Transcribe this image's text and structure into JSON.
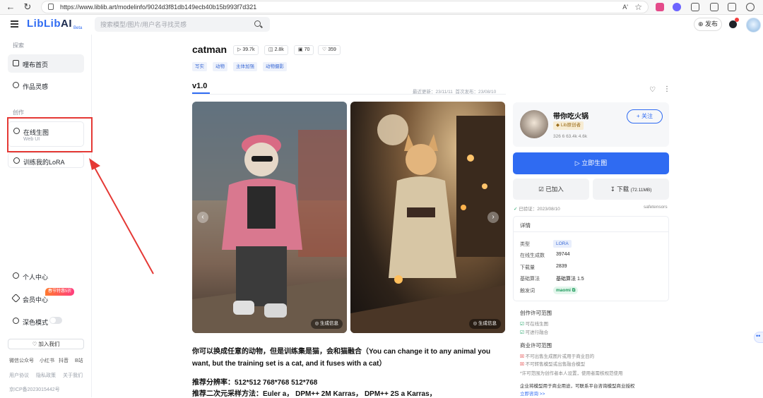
{
  "browser": {
    "url": "https://www.liblib.art/modelinfo/9024d3f81db149ecb40b15b993f7d321",
    "reader_label": "Aʹ"
  },
  "header": {
    "logo": "LibLib",
    "logo_suffix": "AI",
    "logo_beta": "Beta",
    "search_placeholder": "搜索模型/图片/用户名寻找灵感",
    "publish_label": "发布"
  },
  "sidebar": {
    "section_explore": "探索",
    "home_label": "哩布首页",
    "inspiration_label": "作品灵感",
    "section_create": "创作",
    "create_label": "在线生图",
    "create_sub": "Web UI",
    "train_label": "训练我的LoRA",
    "profile_label": "个人中心",
    "vip_label": "会员中心",
    "vip_badge": "春节特惠5折",
    "dark_label": "深色模式",
    "join_label": "加入我们",
    "footer_row1": [
      "微信公众号",
      "小红书",
      "抖音",
      "B站"
    ],
    "footer_row2": [
      "用户协议",
      "隐私政策",
      "关于我们"
    ],
    "icp": "京ICP备2023015442号"
  },
  "model": {
    "title": "catman",
    "stats": {
      "runs": "39.7k",
      "downloads": "2.8k",
      "images": "70",
      "likes": "359"
    },
    "tags": [
      "写实",
      "动物",
      "主体加强",
      "动物摄影"
    ],
    "version": "v1.0",
    "last_update": "最近更新：23/11/11",
    "first_publish": "首次发布：23/08/10",
    "gen_info_label": "生成信息",
    "description": "你可以换成任意的动物，但是训练集是猫，会和猫融合（You can change it to any animal you want, but the training set is a cat, and it fuses with a cat）",
    "resolution": "推荐分辨率：512*512 768*768 512*768",
    "sampler": "推荐二次元采样方法：Euler a， DPM++ 2M Karras， DPM++ 2S a Karras，"
  },
  "author": {
    "name": "带你吃火锅",
    "badge": "Lib原创者",
    "stats": "326   6   63.4k   4.6k",
    "follow_label": "关注"
  },
  "actions": {
    "generate_label": "立即生图",
    "added_label": "已加入",
    "download_label": "下载",
    "download_size": "(72.11MB)",
    "verified": "已验证：2023/08/10",
    "format": "safetensors"
  },
  "details": {
    "title": "详情",
    "rows": [
      {
        "label": "类型",
        "value": "LORA"
      },
      {
        "label": "在线生成数",
        "value": "39744"
      },
      {
        "label": "下载量",
        "value": "2839"
      },
      {
        "label": "基础算法",
        "value": "基础算法 1.5"
      },
      {
        "label": "触发词",
        "value": "maomi"
      }
    ]
  },
  "license": {
    "creation_head": "创作许可范围",
    "creation_items": [
      "可在线生图",
      "可进行融合"
    ],
    "commercial_head": "商业许可范围",
    "commercial_items": [
      "不可出售生成图片或用于商业目的",
      "不可转售模型或出售融合模型"
    ],
    "note": "*许可范围为创作者本人设置，使用者需核规范使用",
    "enterprise": "企业将模型用于商业用途，可联系平台咨询模型商业授权",
    "consult_link": "立即咨询 >>"
  },
  "colors": {
    "accent": "#2f6bf2",
    "highlight_box": "#e53935"
  }
}
